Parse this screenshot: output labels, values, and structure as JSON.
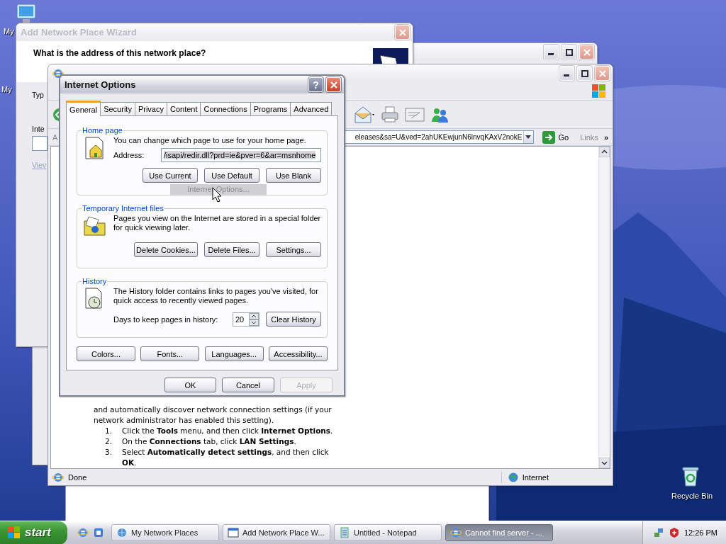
{
  "desktop": {
    "icons": [
      {
        "label": "My"
      },
      {
        "label": "My"
      }
    ],
    "recycle_bin": {
      "label": "Recycle Bin"
    }
  },
  "wizard": {
    "title": "Add Network Place Wizard",
    "heading": "What is the address of this network place?",
    "label_1": "Typ",
    "label_2": "Inte",
    "link": "Viev"
  },
  "browser": {
    "address_label": "A",
    "address": "eleases&sa=U&ved=2ahUKEwjunN6lnvqKAxV2nokE",
    "go": "Go",
    "links": "Links",
    "more": "»",
    "content": {
      "intro": "and automatically discover network connection settings (if your network administrator has enabled this setting).",
      "steps": [
        {
          "number": "1.",
          "text": "Click the **Tools** menu, and then click **Internet Options**."
        },
        {
          "number": "2.",
          "text": "On the **Connections** tab, click **LAN Settings**."
        },
        {
          "number": "3.",
          "text": "Select **Automatically detect settings**, and then click **OK**."
        }
      ]
    },
    "status": "Done",
    "zone": "Internet"
  },
  "dialog": {
    "title": "Internet Options",
    "help": "?",
    "tabs": [
      {
        "label": "General",
        "selected": true
      },
      {
        "label": "Security",
        "selected": false
      },
      {
        "label": "Privacy",
        "selected": false
      },
      {
        "label": "Content",
        "selected": false
      },
      {
        "label": "Connections",
        "selected": false
      },
      {
        "label": "Programs",
        "selected": false
      },
      {
        "label": "Advanced",
        "selected": false
      }
    ],
    "home_page": {
      "legend": "Home page",
      "text": "You can change which page to use for your home page.",
      "address_label": "Address:",
      "address": "/isapi/redir.dll?prd=ie&pver=6&ar=msnhome",
      "buttons": [
        "Use Current",
        "Use Default",
        "Use Blank"
      ]
    },
    "temp_files": {
      "legend": "Temporary Internet files",
      "text": "Pages you view on the Internet are stored in a special folder for quick viewing later.",
      "buttons": [
        "Delete Cookies...",
        "Delete Files...",
        "Settings..."
      ]
    },
    "history": {
      "legend": "History",
      "text": "The History folder contains links to pages you've visited, for quick access to recently viewed pages.",
      "days_label": "Days to keep pages in history:",
      "days": "20",
      "button": "Clear History"
    },
    "bottom_buttons": [
      "Colors...",
      "Fonts...",
      "Languages...",
      "Accessibility..."
    ],
    "footer": [
      {
        "label": "OK",
        "disabled": false
      },
      {
        "label": "Cancel",
        "disabled": false
      },
      {
        "label": "Apply",
        "disabled": true
      }
    ]
  },
  "drag_ghost": "Internet Options...",
  "taskbar": {
    "start": "start",
    "items": [
      {
        "label": "My Network Places",
        "kind": "places",
        "selected": false
      },
      {
        "label": "Add Network Place W...",
        "kind": "wizard",
        "selected": false
      },
      {
        "label": "Untitled - Notepad",
        "kind": "notepad",
        "selected": false
      },
      {
        "label": "Cannot find server - ...",
        "kind": "browser",
        "selected": true
      }
    ],
    "clock": "12:26 PM"
  }
}
